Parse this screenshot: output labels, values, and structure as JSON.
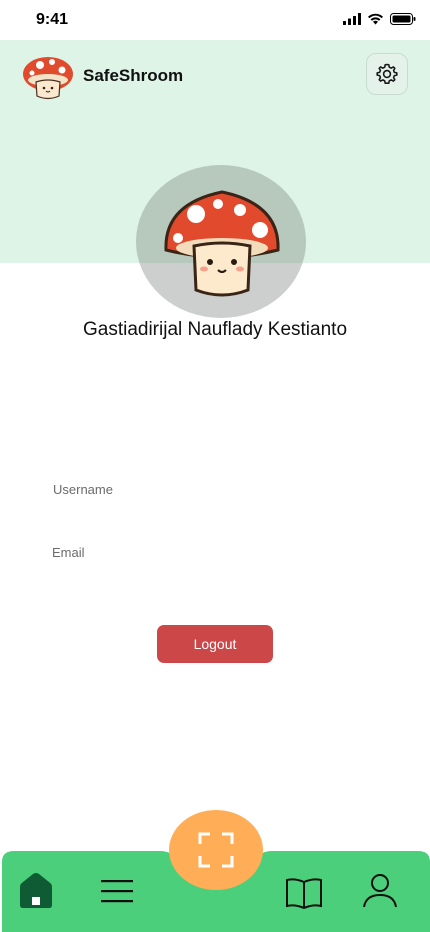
{
  "status_bar": {
    "time": "9:41"
  },
  "header": {
    "app_name": "SafeShroom",
    "logo": "mushroom-icon",
    "settings_icon": "gear-icon"
  },
  "profile": {
    "name": "Gastiadirijal Nauflady Kestianto",
    "avatar": "mushroom-avatar",
    "username_label": "Username",
    "email_label": "Email"
  },
  "actions": {
    "logout_label": "Logout"
  },
  "bottom_nav": {
    "items": [
      {
        "icon": "home-icon",
        "active": true
      },
      {
        "icon": "menu-icon"
      },
      {
        "icon": "scan-icon"
      },
      {
        "icon": "book-icon"
      },
      {
        "icon": "profile-icon"
      }
    ]
  },
  "colors": {
    "header_bg": "#ddf4e6",
    "nav_bg": "#4ccf7b",
    "nav_active": "#0f5b33",
    "fab": "#ffad56",
    "logout": "#cc4848"
  }
}
